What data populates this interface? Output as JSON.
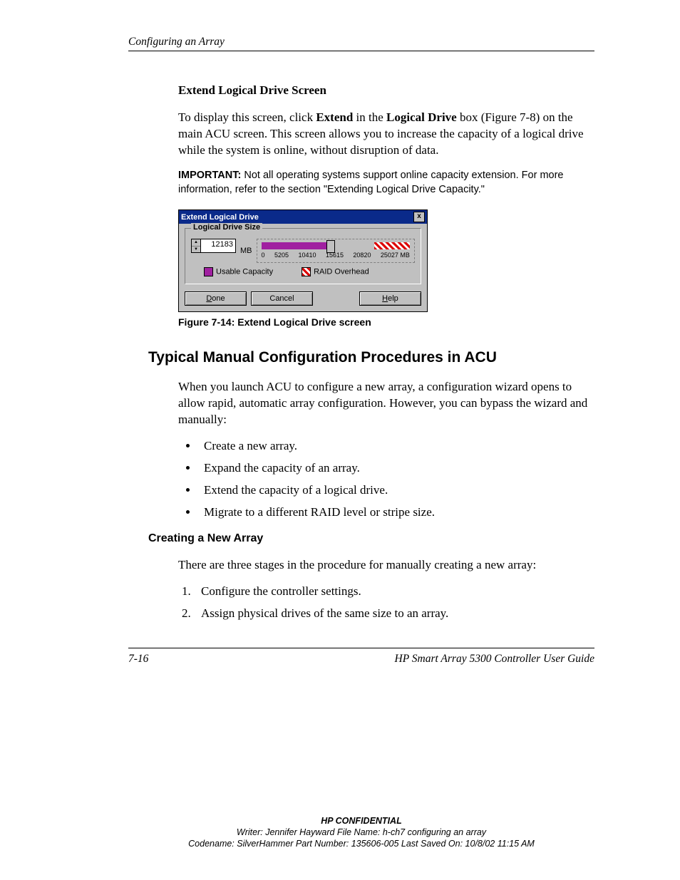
{
  "runhead": "Configuring an Array",
  "section": {
    "heading": "Extend Logical Drive Screen",
    "para1_pre": "To display this screen, click ",
    "para1_b1": "Extend",
    "para1_mid1": " in the ",
    "para1_b2": "Logical Drive",
    "para1_mid2": " box (Figure 7-8) on the main ACU screen. This screen allows you to increase the capacity of a logical drive while the system is online, without disruption of data.",
    "note_label": "IMPORTANT:",
    "note_text": "  Not all operating systems support online capacity extension. For more information, refer to the section \"Extending Logical Drive Capacity.\"",
    "figcaption": "Figure 7-14:  Extend Logical Drive screen"
  },
  "dialog": {
    "title": "Extend Logical Drive",
    "close": "x",
    "group_label": "Logical Drive Size",
    "spin_value": "12183",
    "mb": "MB",
    "ticks": [
      "0",
      "5205",
      "10410",
      "15615",
      "20820",
      "25027 MB"
    ],
    "legend_usable": "Usable Capacity",
    "legend_raid": "RAID Overhead",
    "btn_done": "Done",
    "btn_cancel": "Cancel",
    "btn_help": "Help"
  },
  "h2": "Typical Manual Configuration Procedures in ACU",
  "para2": "When you launch ACU to configure a new array, a configuration wizard opens to allow rapid, automatic array configuration. However, you can bypass the wizard and manually:",
  "bullets": [
    "Create a new array.",
    "Expand the capacity of an array.",
    "Extend the capacity of a logical drive.",
    "Migrate to a different RAID level or stripe size."
  ],
  "h4": "Creating a New Array",
  "para3": "There are three stages in the procedure for manually creating a new array:",
  "steps": [
    "Configure the controller settings.",
    "Assign physical drives of the same size to an array."
  ],
  "footer": {
    "page": "7-16",
    "guide": "HP Smart Array 5300 Controller User Guide"
  },
  "confidential": {
    "line1": "HP CONFIDENTIAL",
    "line2": "Writer: Jennifer Hayward File Name: h-ch7 configuring an array",
    "line3": "Codename: SilverHammer Part Number: 135606-005 Last Saved On: 10/8/02 11:15 AM"
  },
  "chart_data": {
    "type": "bar",
    "title": "Logical Drive Size slider",
    "xlabel": "MB",
    "ylabel": "",
    "xlim": [
      0,
      25027
    ],
    "ticks": [
      0,
      5205,
      10410,
      15615,
      20820,
      25027
    ],
    "current_value": 12183,
    "series": [
      {
        "name": "Usable Capacity",
        "range": [
          0,
          12183
        ]
      },
      {
        "name": "RAID Overhead",
        "range": [
          20000,
          25027
        ]
      }
    ]
  }
}
